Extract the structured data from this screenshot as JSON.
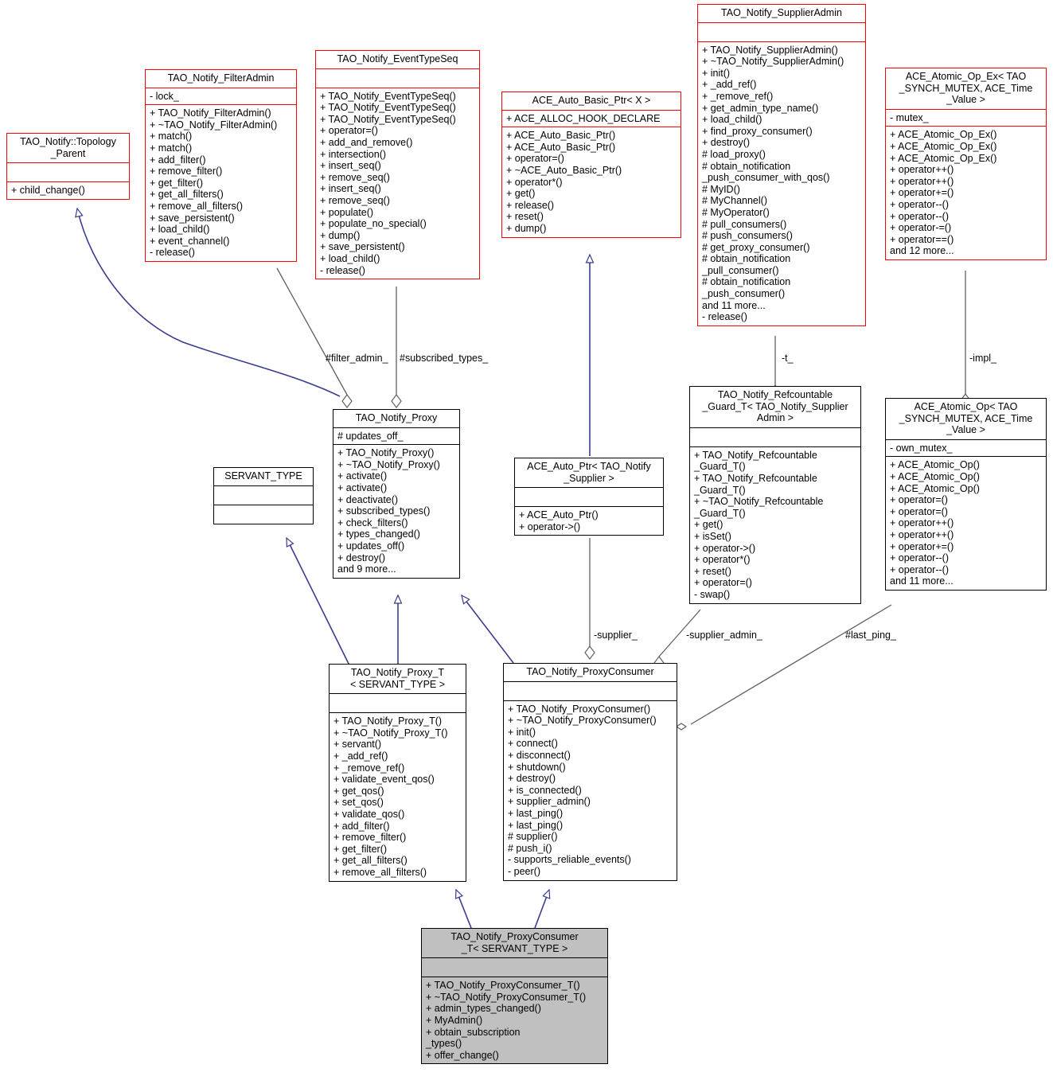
{
  "diagram": {
    "title": "TAO_Notify_ProxyConsumer_T class collaboration diagram",
    "colors": {
      "class_border_highlight": "#ff0000",
      "class_border_normal": "#000000",
      "inheritance_edge": "#3b3b8f",
      "association_edge": "#606060",
      "focus_fill": "#c0c0c0",
      "background": "#ffffff"
    }
  },
  "nodes": [
    {
      "id": "topology_parent",
      "name": "TAO_Notify::Topology\n_Parent",
      "attributes": [],
      "operations": [
        "+ child_change()"
      ],
      "highlight": true
    },
    {
      "id": "filter_admin",
      "name": "TAO_Notify_FilterAdmin",
      "attributes": [
        "- lock_"
      ],
      "operations": [
        "+ TAO_Notify_FilterAdmin()",
        "+ ~TAO_Notify_FilterAdmin()",
        "+ match()",
        "+ match()",
        "+ add_filter()",
        "+ remove_filter()",
        "+ get_filter()",
        "+ get_all_filters()",
        "+ remove_all_filters()",
        "+ save_persistent()",
        "+ load_child()",
        "+ event_channel()",
        "- release()"
      ],
      "highlight": true
    },
    {
      "id": "event_type_seq",
      "name": "TAO_Notify_EventTypeSeq",
      "attributes": [],
      "operations": [
        "+ TAO_Notify_EventTypeSeq()",
        "+ TAO_Notify_EventTypeSeq()",
        "+ TAO_Notify_EventTypeSeq()",
        "+ operator=()",
        "+ add_and_remove()",
        "+ intersection()",
        "+ insert_seq()",
        "+ remove_seq()",
        "+ insert_seq()",
        "+ remove_seq()",
        "+ populate()",
        "+ populate_no_special()",
        "+ dump()",
        "+ save_persistent()",
        "+ load_child()",
        "- release()"
      ],
      "highlight": true
    },
    {
      "id": "auto_basic_ptr",
      "name": "ACE_Auto_Basic_Ptr< X >",
      "attributes": [
        "+ ACE_ALLOC_HOOK_DECLARE"
      ],
      "operations": [
        "+ ACE_Auto_Basic_Ptr()",
        "+ ACE_Auto_Basic_Ptr()",
        "+ operator=()",
        "+ ~ACE_Auto_Basic_Ptr()",
        "+ operator*()",
        "+ get()",
        "+ release()",
        "+ reset()",
        "+ dump()"
      ],
      "highlight": true
    },
    {
      "id": "supplier_admin",
      "name": "TAO_Notify_SupplierAdmin",
      "attributes": [],
      "operations": [
        "+ TAO_Notify_SupplierAdmin()",
        "+ ~TAO_Notify_SupplierAdmin()",
        "+ init()",
        "+ _add_ref()",
        "+ _remove_ref()",
        "+ get_admin_type_name()",
        "+ load_child()",
        "+ find_proxy_consumer()",
        "+ destroy()",
        "# load_proxy()",
        "# obtain_notification\n_push_consumer_with_qos()",
        "# MyID()",
        "# MyChannel()",
        "# MyOperator()",
        "# pull_consumers()",
        "# push_consumers()",
        "# get_proxy_consumer()",
        "# obtain_notification\n_pull_consumer()",
        "# obtain_notification\n_push_consumer()",
        "and 11 more...",
        "- release()"
      ],
      "highlight": true
    },
    {
      "id": "atomic_op_ex",
      "name": "ACE_Atomic_Op_Ex< TAO\n_SYNCH_MUTEX, ACE_Time\n_Value >",
      "attributes": [
        "- mutex_"
      ],
      "operations": [
        "+ ACE_Atomic_Op_Ex()",
        "+ ACE_Atomic_Op_Ex()",
        "+ ACE_Atomic_Op_Ex()",
        "+ operator++()",
        "+ operator++()",
        "+ operator+=()",
        "+ operator--()",
        "+ operator--()",
        "+ operator-=()",
        "+ operator==()",
        "and 12 more..."
      ],
      "highlight": true
    },
    {
      "id": "notify_proxy",
      "name": "TAO_Notify_Proxy",
      "attributes": [
        "# updates_off_"
      ],
      "operations": [
        "+ TAO_Notify_Proxy()",
        "+ ~TAO_Notify_Proxy()",
        "+ activate()",
        "+ activate()",
        "+ deactivate()",
        "+ subscribed_types()",
        "+ check_filters()",
        "+ types_changed()",
        "+ updates_off()",
        "+ destroy()",
        "and 9 more..."
      ],
      "highlight": false
    },
    {
      "id": "servant_type",
      "name": "SERVANT_TYPE",
      "attributes": [],
      "operations": [],
      "highlight": false
    },
    {
      "id": "auto_ptr_supplier",
      "name": "ACE_Auto_Ptr< TAO_Notify\n_Supplier >",
      "attributes": [],
      "operations": [
        "+ ACE_Auto_Ptr()",
        "+ operator->()"
      ],
      "highlight": false
    },
    {
      "id": "refcountable_guard",
      "name": "TAO_Notify_Refcountable\n_Guard_T< TAO_Notify_Supplier\nAdmin >",
      "attributes": [],
      "operations": [
        "+ TAO_Notify_Refcountable\n_Guard_T()",
        "+ TAO_Notify_Refcountable\n_Guard_T()",
        "+ ~TAO_Notify_Refcountable\n_Guard_T()",
        "+ get()",
        "+ isSet()",
        "+ operator->()",
        "+ operator*()",
        "+ reset()",
        "+ operator=()",
        "- swap()"
      ],
      "highlight": false
    },
    {
      "id": "atomic_op",
      "name": "ACE_Atomic_Op< TAO\n_SYNCH_MUTEX, ACE_Time\n_Value >",
      "attributes": [
        "- own_mutex_"
      ],
      "operations": [
        "+ ACE_Atomic_Op()",
        "+ ACE_Atomic_Op()",
        "+ ACE_Atomic_Op()",
        "+ operator=()",
        "+ operator=()",
        "+ operator++()",
        "+ operator++()",
        "+ operator+=()",
        "+ operator--()",
        "+ operator--()",
        "and 11 more..."
      ],
      "highlight": false
    },
    {
      "id": "notify_proxy_t",
      "name": "TAO_Notify_Proxy_T\n< SERVANT_TYPE >",
      "attributes": [],
      "operations": [
        "+ TAO_Notify_Proxy_T()",
        "+ ~TAO_Notify_Proxy_T()",
        "+ servant()",
        "+ _add_ref()",
        "+ _remove_ref()",
        "+ validate_event_qos()",
        "+ get_qos()",
        "+ set_qos()",
        "+ validate_qos()",
        "+ add_filter()",
        "+ remove_filter()",
        "+ get_filter()",
        "+ get_all_filters()",
        "+ remove_all_filters()"
      ],
      "highlight": false
    },
    {
      "id": "proxy_consumer",
      "name": "TAO_Notify_ProxyConsumer",
      "attributes": [],
      "operations": [
        "+ TAO_Notify_ProxyConsumer()",
        "+ ~TAO_Notify_ProxyConsumer()",
        "+ init()",
        "+ connect()",
        "+ disconnect()",
        "+ shutdown()",
        "+ destroy()",
        "+ is_connected()",
        "+ supplier_admin()",
        "+ last_ping()",
        "+ last_ping()",
        "# supplier()",
        "# push_i()",
        "- supports_reliable_events()",
        "- peer()"
      ],
      "highlight": false
    },
    {
      "id": "proxy_consumer_t",
      "name": "TAO_Notify_ProxyConsumer\n_T< SERVANT_TYPE >",
      "attributes": [],
      "operations": [
        "+ TAO_Notify_ProxyConsumer_T()",
        "+ ~TAO_Notify_ProxyConsumer_T()",
        "+ admin_types_changed()",
        "+ MyAdmin()",
        "+ obtain_subscription\n_types()",
        "+ offer_change()"
      ],
      "highlight": false,
      "focus": true
    }
  ],
  "edge_labels": [
    {
      "id": "filter_admin_label",
      "text": "#filter_admin_"
    },
    {
      "id": "subscribed_types_label",
      "text": "#subscribed_types_"
    },
    {
      "id": "t_label",
      "text": "-t_"
    },
    {
      "id": "impl_label",
      "text": "-impl_"
    },
    {
      "id": "supplier_label",
      "text": "-supplier_"
    },
    {
      "id": "supplier_admin_label",
      "text": "-supplier_admin_"
    },
    {
      "id": "last_ping_label",
      "text": "#last_ping_"
    }
  ]
}
